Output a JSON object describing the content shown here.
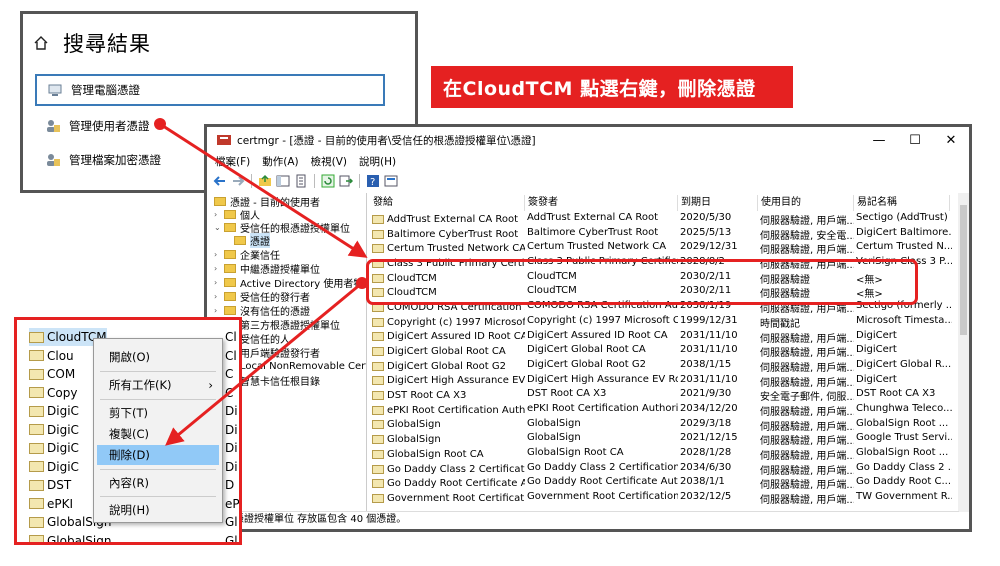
{
  "search_panel": {
    "title": "搜尋結果",
    "items": [
      {
        "label": "管理電腦憑證",
        "icon": "computer-cert-icon"
      },
      {
        "label": "管理使用者憑證",
        "icon": "user-cert-icon"
      },
      {
        "label": "管理檔案加密憑證",
        "icon": "file-encryption-cert-icon"
      }
    ]
  },
  "banner": {
    "text": "在CloudTCM 點選右鍵，刪除憑證"
  },
  "window": {
    "title": "certmgr - [憑證 - 目前的使用者\\受信任的根憑證授權單位\\憑證]",
    "controls": {
      "minimize": "—",
      "maximize": "☐",
      "close": "✕"
    },
    "menu": [
      "檔案(F)",
      "動作(A)",
      "檢視(V)",
      "說明(H)"
    ],
    "tree": [
      {
        "label": "憑證 - 目前的使用者"
      },
      {
        "label": "個人"
      },
      {
        "label": "受信任的根憑證授權單位"
      },
      {
        "label": "憑證"
      },
      {
        "label": "企業信任"
      },
      {
        "label": "中繼憑證授權單位"
      },
      {
        "label": "Active Directory 使用者物件"
      },
      {
        "label": "受信任的發行者"
      },
      {
        "label": "沒有信任的憑證"
      },
      {
        "label": "第三方根憑證授權單位"
      },
      {
        "label": "受信任的人"
      },
      {
        "label": "用戶端驗證發行者"
      },
      {
        "label": "Local NonRemovable Certi"
      },
      {
        "label": "智慧卡信任根目錄"
      }
    ],
    "columns": [
      "發給",
      "簽發者",
      "到期日",
      "使用目的",
      "易記名稱"
    ],
    "rows": [
      [
        "AddTrust External CA Root",
        "AddTrust External CA Root",
        "2020/5/30",
        "伺服器驗證, 用戶端...",
        "Sectigo (AddTrust)"
      ],
      [
        "Baltimore CyberTrust Root",
        "Baltimore CyberTrust Root",
        "2025/5/13",
        "伺服器驗證, 安全電...",
        "DigiCert Baltimore..."
      ],
      [
        "Certum Trusted Network CA",
        "Certum Trusted Network CA",
        "2029/12/31",
        "伺服器驗證, 用戶端...",
        "Certum Trusted N..."
      ],
      [
        "Class 3 Public Primary Certific...",
        "Class 3 Public Primary Certificat...",
        "2028/8/2",
        "伺服器驗證, 用戶端...",
        "VeriSign Class 3 P..."
      ],
      [
        "CloudTCM",
        "CloudTCM",
        "2030/2/11",
        "伺服器驗證",
        "<無>"
      ],
      [
        "CloudTCM",
        "CloudTCM",
        "2030/2/11",
        "伺服器驗證",
        "<無>"
      ],
      [
        "COMODO RSA Certification A...",
        "COMODO RSA Certification Au...",
        "2038/1/19",
        "伺服器驗證, 用戶端...",
        "Sectigo (formerly ..."
      ],
      [
        "Copyright (c) 1997 Microsoft ...",
        "Copyright (c) 1997 Microsoft C...",
        "1999/12/31",
        "時間戳記",
        "Microsoft Timesta..."
      ],
      [
        "DigiCert Assured ID Root CA",
        "DigiCert Assured ID Root CA",
        "2031/11/10",
        "伺服器驗證, 用戶端...",
        "DigiCert"
      ],
      [
        "DigiCert Global Root CA",
        "DigiCert Global Root CA",
        "2031/11/10",
        "伺服器驗證, 用戶端...",
        "DigiCert"
      ],
      [
        "DigiCert Global Root G2",
        "DigiCert Global Root G2",
        "2038/1/15",
        "伺服器驗證, 用戶端...",
        "DigiCert Global R..."
      ],
      [
        "DigiCert High Assurance EV R...",
        "DigiCert High Assurance EV Ro...",
        "2031/11/10",
        "伺服器驗證, 用戶端...",
        "DigiCert"
      ],
      [
        "DST Root CA X3",
        "DST Root CA X3",
        "2021/9/30",
        "安全電子郵件, 伺服...",
        "DST Root CA X3"
      ],
      [
        "ePKI Root Certification Author...",
        "ePKI Root Certification Authority",
        "2034/12/20",
        "伺服器驗證, 用戶端...",
        "Chunghwa Teleco..."
      ],
      [
        "GlobalSign",
        "GlobalSign",
        "2029/3/18",
        "伺服器驗證, 用戶端...",
        "GlobalSign Root ..."
      ],
      [
        "GlobalSign",
        "GlobalSign",
        "2021/12/15",
        "伺服器驗證, 用戶端...",
        "Google Trust Servi..."
      ],
      [
        "GlobalSign Root CA",
        "GlobalSign Root CA",
        "2028/1/28",
        "伺服器驗證, 用戶端...",
        "GlobalSign Root ..."
      ],
      [
        "Go Daddy Class 2 Certificatio...",
        "Go Daddy Class 2 Certification ...",
        "2034/6/30",
        "伺服器驗證, 用戶端...",
        "Go Daddy Class 2 ..."
      ],
      [
        "Go Daddy Root Certificate Au...",
        "Go Daddy Root Certificate Auth...",
        "2038/1/1",
        "伺服器驗證, 用戶端...",
        "Go Daddy Root C..."
      ],
      [
        "Government Root Certificatio...",
        "Government Root Certification ...",
        "2032/12/5",
        "伺服器驗證, 用戶端...",
        "TW Government R..."
      ]
    ],
    "status": "的根憑證授權單位 存放區包含 40 個憑證。"
  },
  "inset": {
    "rows": [
      {
        "label": "CloudTCM",
        "right": "Cl"
      },
      {
        "label": "Clou",
        "right": "Cl"
      },
      {
        "label": "COM",
        "right": "C"
      },
      {
        "label": "Copy",
        "right": "C"
      },
      {
        "label": "DigiC",
        "right": "Di"
      },
      {
        "label": "DigiC",
        "right": "Di"
      },
      {
        "label": "DigiC",
        "right": "Di"
      },
      {
        "label": "DigiC",
        "right": "Di"
      },
      {
        "label": "DST",
        "right": "D"
      },
      {
        "label": "ePKI",
        "right": "eP"
      },
      {
        "label": "GlobalSign",
        "right": "Gl"
      },
      {
        "label": "GlobalSign",
        "right": "Gl"
      }
    ],
    "menu": [
      {
        "label": "開啟(O)"
      },
      {
        "label": "所有工作(K)",
        "submenu": "›"
      },
      {
        "label": "剪下(T)"
      },
      {
        "label": "複製(C)"
      },
      {
        "label": "刪除(D)"
      },
      {
        "label": "內容(R)"
      },
      {
        "label": "說明(H)"
      }
    ]
  },
  "colors": {
    "accent_red": "#e52121",
    "selection_blue": "#91c9f7"
  }
}
